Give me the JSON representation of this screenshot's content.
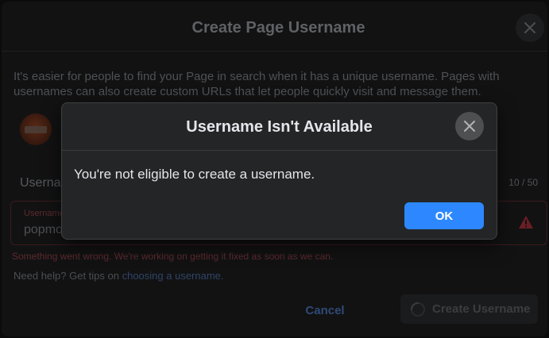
{
  "dialog": {
    "title": "Create Page Username",
    "intro": "It's easier for people to find your Page in search when it has a unique username. Pages with usernames can also create custom URLs that let people quickly visit and message them.",
    "field_label": "Userna",
    "char_count": "10 / 50",
    "input": {
      "floating_label": "Username",
      "value": "popmo"
    },
    "error": "Something went wrong. We're working on getting it fixed as soon as we can.",
    "help_prefix": "Need help? Get tips on ",
    "help_link": "choosing a username.",
    "cancel_label": "Cancel",
    "create_label": "Create Username"
  },
  "modal": {
    "title": "Username Isn't Available",
    "message": "You're not eligible to create a username.",
    "ok_label": "OK"
  },
  "colors": {
    "accent": "#2d88ff",
    "modal_bg": "#242526",
    "error": "#e41e3f"
  }
}
